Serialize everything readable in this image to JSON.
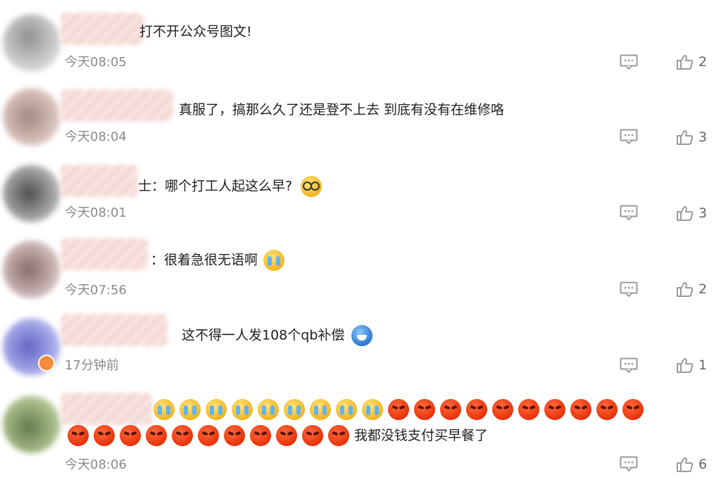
{
  "comments": [
    {
      "text": "打不开公众号图文!",
      "time": "今天08:05",
      "likes": "2"
    },
    {
      "text": "真服了，搞那么久了还是登不上去 到底有没有在维修咯",
      "time": "今天08:04",
      "likes": "3"
    },
    {
      "text": "士：哪个打工人起这么早?",
      "time": "今天08:01",
      "likes": "3",
      "emoji": "glasses-emoji"
    },
    {
      "text": "：很着急很无语啊",
      "time": "今天07:56",
      "likes": "2",
      "emoji": "crying-emoji"
    },
    {
      "text": "这不得一人发108个qb补偿",
      "time": "17分钟前",
      "likes": "1",
      "emoji": "shark-emoji"
    },
    {
      "text": "我都没钱支付买早餐了",
      "time": "今天08:06",
      "likes": "6",
      "emoji": "crying-and-angry-emoji-sequence"
    }
  ],
  "icons": {
    "reply": "reply-icon",
    "like": "thumbs-up-icon"
  },
  "colors": {
    "time": "#8a8a8a",
    "text": "#1e1e1e",
    "icon": "#9a9a9a",
    "angry": "#e8320a"
  }
}
